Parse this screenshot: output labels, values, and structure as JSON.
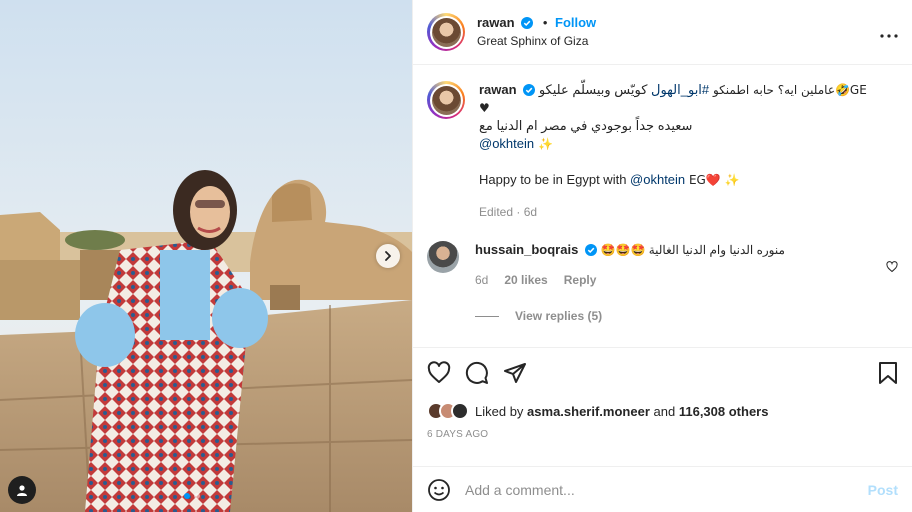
{
  "post": {
    "author": {
      "username": "rawan",
      "verified": true,
      "follow_label": "Follow",
      "location": "Great Sphinx of Giza"
    },
    "more_icon": "more-horizontal-icon",
    "image_controls": {
      "next_icon": "chevron-right-icon",
      "tag_icon": "user-tag-icon",
      "dot_count": 2,
      "active_dot": 0
    },
    "caption": {
      "username": "rawan",
      "line1_prefix": "GE🤣عاملين ايه؟ حابه اطمنكو ",
      "line1_hashtag": "#ابو_الهول",
      "line1_suffix": " كويّس وبيسلّم عليكو",
      "line2": "♥",
      "line3": "سعيده جداً بوجودي في مصر ام الدنيا مع",
      "line4_mention": "@okhtein",
      "line4_emoji": " ✨",
      "line5_prefix": "Happy to be in Egypt with ",
      "line5_mention": "@okhtein",
      "line5_suffix": " EG❤️ ✨",
      "meta": "Edited · 6d"
    },
    "comments": [
      {
        "username": "hussain_boqrais",
        "verified": true,
        "text": "منوره الدنيا وام الدنيا الغالية 🤩🤩🤩",
        "age": "6d",
        "likes": "20 likes",
        "reply_label": "Reply",
        "view_replies": "View replies (5)"
      }
    ],
    "actions": {
      "like_icon": "heart-icon",
      "comment_icon": "comment-icon",
      "share_icon": "share-icon",
      "save_icon": "bookmark-icon"
    },
    "likes": {
      "prefix": "Liked by ",
      "user": "asma.sherif.moneer",
      "middle": " and ",
      "others": "116,308 others"
    },
    "timestamp": "6 DAYS AGO",
    "add_comment": {
      "placeholder": "Add a comment...",
      "post_label": "Post",
      "emoji_icon": "emoji-icon"
    }
  },
  "colors": {
    "accent": "#0095f6",
    "link": "#00376b",
    "muted": "#8e8e8e",
    "post_disabled": "#b2dffc"
  }
}
